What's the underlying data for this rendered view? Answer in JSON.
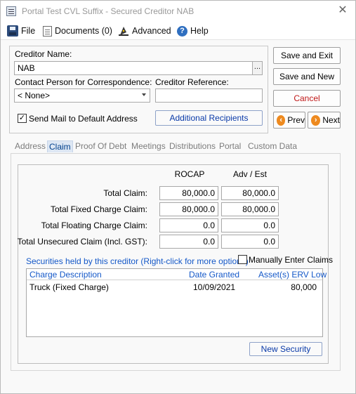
{
  "window": {
    "title": "Portal Test CVL Suffix - Secured Creditor NAB",
    "close_glyph": "✕"
  },
  "toolbar": {
    "file": {
      "label": "File",
      "icon": "file-icon"
    },
    "documents": {
      "label": "Documents (0)",
      "icon": "document-icon"
    },
    "advanced": {
      "label": "Advanced",
      "icon": "wizard-hat-icon"
    },
    "help": {
      "label": "Help",
      "icon": "help-icon"
    }
  },
  "creditor": {
    "name_label": "Creditor Name:",
    "name_value": "NAB",
    "name_browse": "...",
    "contact_label": "Contact Person for Correspondence:",
    "contact_value": "< None>",
    "reference_label": "Creditor Reference:",
    "reference_value": "",
    "send_mail_label": "Send Mail to Default Address",
    "send_mail_checked": true,
    "additional_recipients_label": "Additional Recipients"
  },
  "actions": {
    "save_exit": "Save and Exit",
    "save_new": "Save and New",
    "cancel": "Cancel",
    "prev": "Prev",
    "next": "Next"
  },
  "tabs": [
    {
      "label": "Address",
      "active": false
    },
    {
      "label": "Claim",
      "active": true
    },
    {
      "label": "Proof Of Debt",
      "active": false
    },
    {
      "label": "Meetings",
      "active": false
    },
    {
      "label": "Distributions",
      "active": false
    },
    {
      "label": "Portal",
      "active": false
    },
    {
      "label": "Custom Data",
      "active": false
    }
  ],
  "claim": {
    "col_rocap": "ROCAP",
    "col_adv_est": "Adv / Est",
    "rows": [
      {
        "label": "Total Claim:",
        "rocap": "80,000.0",
        "adv_est": "80,000.0"
      },
      {
        "label": "Total Fixed Charge Claim:",
        "rocap": "80,000.0",
        "adv_est": "80,000.0"
      },
      {
        "label": "Total Floating Charge Claim:",
        "rocap": "0.0",
        "adv_est": "0.0"
      },
      {
        "label": "Total Unsecured Claim (Incl. GST):",
        "rocap": "0.0",
        "adv_est": "0.0"
      }
    ],
    "securities_label": "Securities held by this creditor (Right-click for more options)",
    "manual_label": "Manually Enter Claims",
    "manual_checked": false,
    "grid_headers": [
      "Charge Description",
      "Date Granted",
      "Asset(s) ERV Low"
    ],
    "grid_rows": [
      {
        "description": "Truck (Fixed Charge)",
        "date": "10/09/2021",
        "erv": "80,000"
      }
    ],
    "new_security_label": "New Security"
  }
}
